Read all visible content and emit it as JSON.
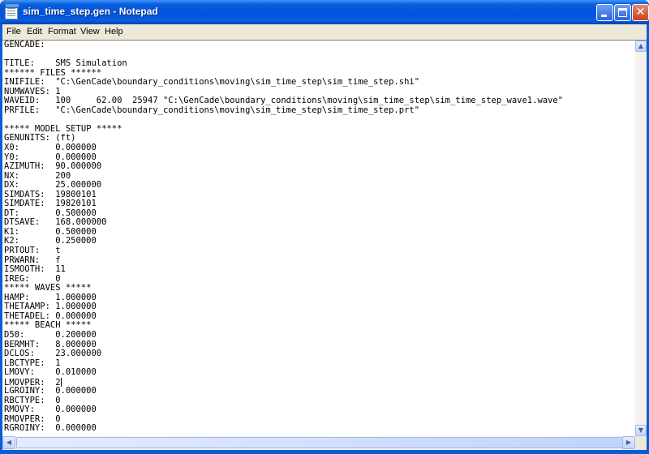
{
  "window": {
    "title": "sim_time_step.gen - Notepad"
  },
  "menu": [
    "File",
    "Edit",
    "Format",
    "View",
    "Help"
  ],
  "document": {
    "lines": [
      "GENCADE:",
      "",
      "TITLE:    SMS Simulation",
      "****** FILES ******",
      "INIFILE:  \"C:\\GenCade\\boundary_conditions\\moving\\sim_time_step\\sim_time_step.shi\"",
      "NUMWAVES: 1",
      "WAVEID:   100     62.00  25947 \"C:\\GenCade\\boundary_conditions\\moving\\sim_time_step\\sim_time_step_wave1.wave\"",
      "PRFILE:   \"C:\\GenCade\\boundary_conditions\\moving\\sim_time_step\\sim_time_step.prt\"",
      "",
      "***** MODEL SETUP *****",
      "GENUNITS: (ft)",
      "X0:       0.000000",
      "Y0:       0.000000",
      "AZIMUTH:  90.000000",
      "NX:       200",
      "DX:       25.000000",
      "SIMDATS:  19800101",
      "SIMDATE:  19820101",
      "DT:       0.500000",
      "DTSAVE:   168.000000",
      "K1:       0.500000",
      "K2:       0.250000",
      "PRTOUT:   t",
      "PRWARN:   f",
      "ISMOOTH:  11",
      "IREG:     0",
      "***** WAVES *****",
      "HAMP:     1.000000",
      "THETAAMP: 1.000000",
      "THETADEL: 0.000000",
      "***** BEACH *****",
      "D50:      0.200000",
      "BERMHT:   8.000000",
      "DCLOS:    23.000000",
      "LBCTYPE:  1",
      "LMOVY:    0.010000",
      "LMOVPER:  2",
      "LGROINY:  0.000000",
      "RBCTYPE:  0",
      "RMOVY:    0.000000",
      "RMOVPER:  0",
      "RGROINY:  0.000000"
    ],
    "caret_line": 36
  },
  "colors": {
    "titlebar": "#0A5DD8",
    "close_button": "#C7421F",
    "menubar": "#ECE9D8"
  }
}
